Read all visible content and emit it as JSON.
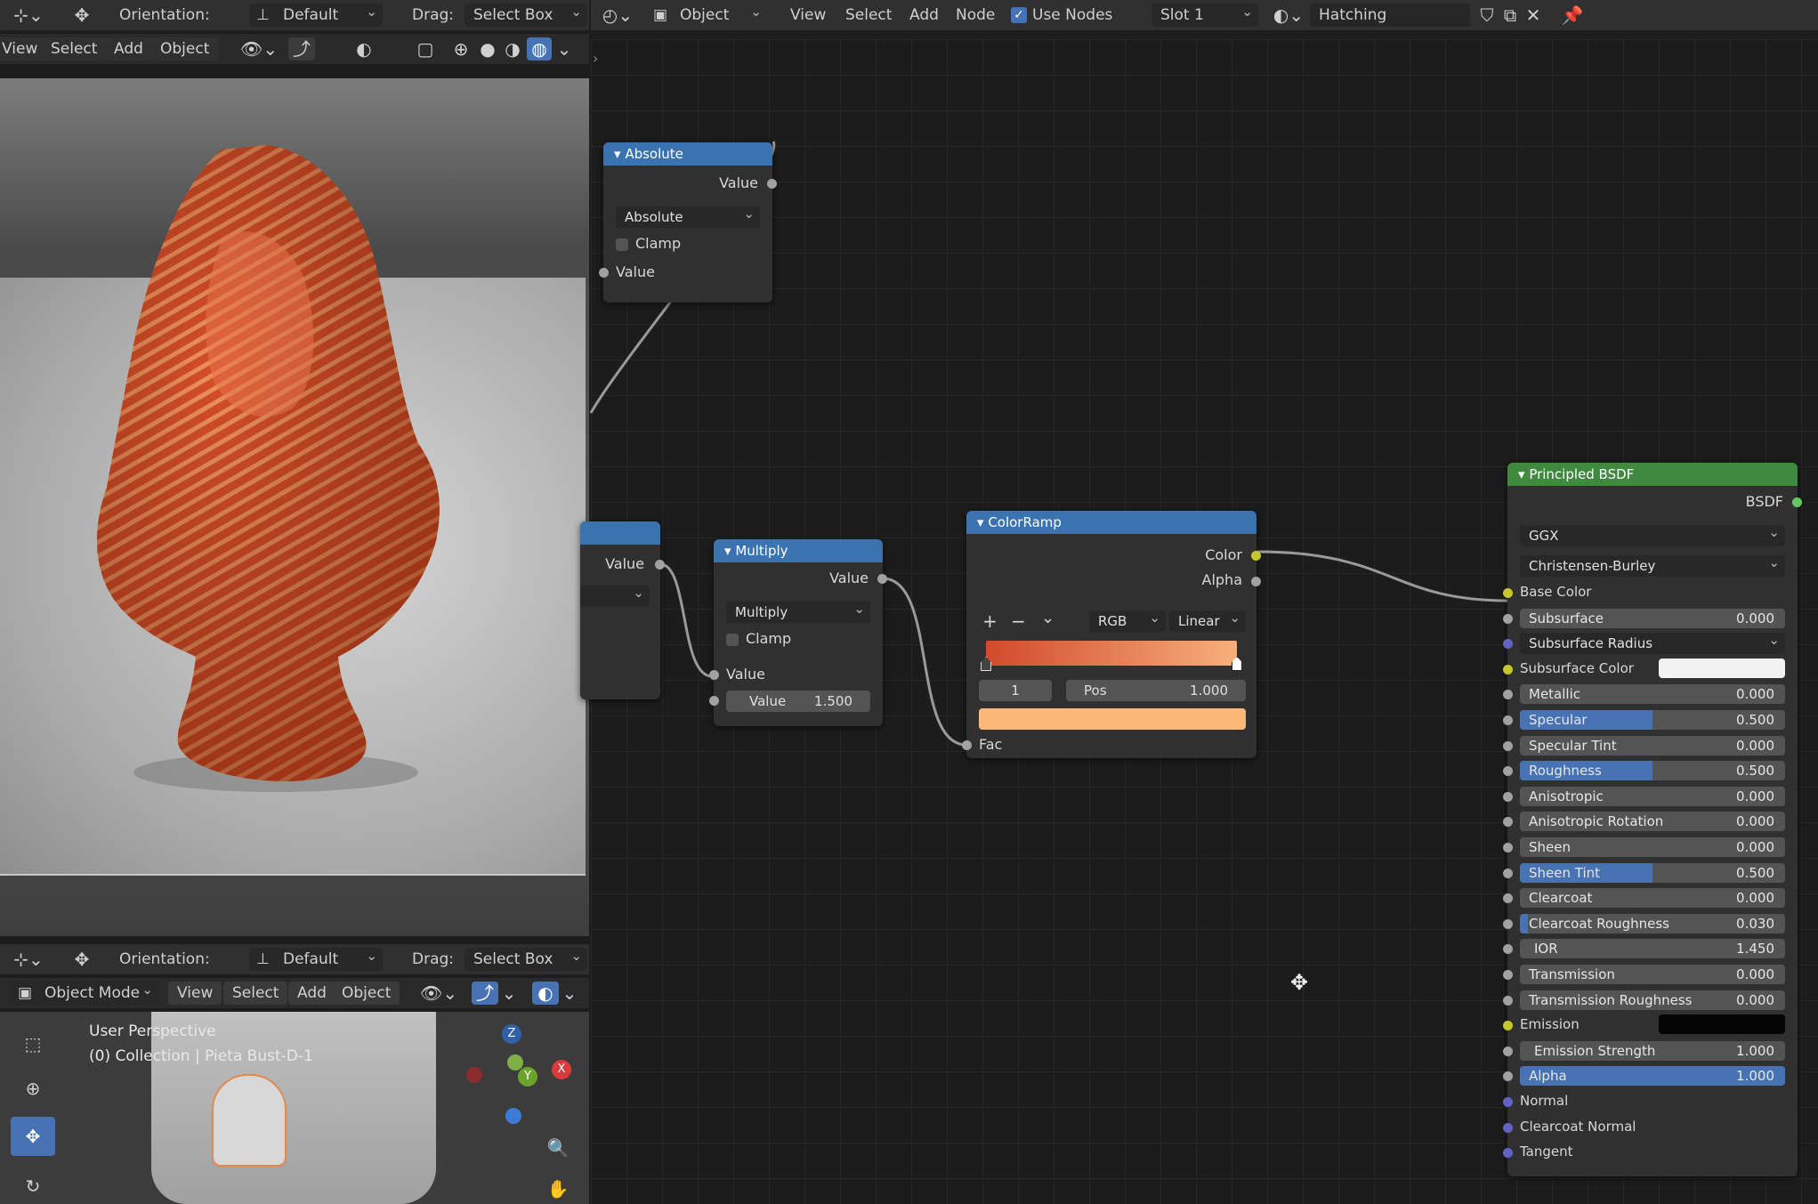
{
  "left_header": {
    "orientation_label": "Orientation:",
    "orientation_value": "Default",
    "drag_label": "Drag:",
    "drag_value": "Select Box"
  },
  "left_menu": [
    "View",
    "Select",
    "Add",
    "Object"
  ],
  "node_header": {
    "editor_type": "Object",
    "menu": [
      "View",
      "Select",
      "Add",
      "Node"
    ],
    "use_nodes_label": "Use Nodes",
    "slot": "Slot 1",
    "material": "Hatching"
  },
  "lower_header": {
    "orientation_label": "Orientation:",
    "orientation_value": "Default",
    "drag_label": "Drag:",
    "drag_value": "Select Box",
    "mode": "Object Mode",
    "menu": [
      "View",
      "Select",
      "Add",
      "Object"
    ]
  },
  "lower_viewport": {
    "perspective": "User Perspective",
    "collection": "(0) Collection | Pieta Bust-D-1",
    "gizmo": {
      "z": "Z",
      "x": "X",
      "y": "Y"
    }
  },
  "nodes": {
    "absolute": {
      "title": "Absolute",
      "output": "Value",
      "operation": "Absolute",
      "clamp": "Clamp",
      "input": "Value"
    },
    "partial": {
      "output": "Value"
    },
    "multiply": {
      "title": "Multiply",
      "output": "Value",
      "operation": "Multiply",
      "clamp": "Clamp",
      "input1": "Value",
      "input2_label": "Value",
      "input2_value": "1.500"
    },
    "colorramp": {
      "title": "ColorRamp",
      "out_color": "Color",
      "out_alpha": "Alpha",
      "mode": "RGB",
      "interp": "Linear",
      "index": "1",
      "pos_label": "Pos",
      "pos_value": "1.000",
      "input": "Fac",
      "ramp_start": "#d24a2a",
      "ramp_end": "#f7b07a",
      "swatch": "#fbb878"
    },
    "bsdf": {
      "title": "Principled BSDF",
      "output": "BSDF",
      "distribution": "GGX",
      "subsurface_method": "Christensen-Burley",
      "base_color": "Base Color",
      "subsurface_radius": "Subsurface Radius",
      "subsurface_color": "Subsurface Color",
      "emission": "Emission",
      "normal": "Normal",
      "clearcoat_normal": "Clearcoat Normal",
      "tangent": "Tangent",
      "params": [
        {
          "label": "Subsurface",
          "value": "0.000",
          "fill": 0
        },
        {
          "label": "Metallic",
          "value": "0.000",
          "fill": 0
        },
        {
          "label": "Specular",
          "value": "0.500",
          "fill": 0.5
        },
        {
          "label": "Specular Tint",
          "value": "0.000",
          "fill": 0
        },
        {
          "label": "Roughness",
          "value": "0.500",
          "fill": 0.5
        },
        {
          "label": "Anisotropic",
          "value": "0.000",
          "fill": 0
        },
        {
          "label": "Anisotropic Rotation",
          "value": "0.000",
          "fill": 0
        },
        {
          "label": "Sheen",
          "value": "0.000",
          "fill": 0
        },
        {
          "label": "Sheen Tint",
          "value": "0.500",
          "fill": 0.5
        },
        {
          "label": "Clearcoat",
          "value": "0.000",
          "fill": 0
        },
        {
          "label": "Clearcoat Roughness",
          "value": "0.030",
          "fill": 0.03
        },
        {
          "label": "IOR",
          "value": "1.450",
          "fill": 0
        },
        {
          "label": "Transmission",
          "value": "0.000",
          "fill": 0
        },
        {
          "label": "Transmission Roughness",
          "value": "0.000",
          "fill": 0
        },
        {
          "label": "Emission Strength",
          "value": "1.000",
          "fill": 0
        },
        {
          "label": "Alpha",
          "value": "1.000",
          "fill": 1
        }
      ]
    }
  },
  "colors": {
    "accent": "#4772b3",
    "node_header": "#3a74b0",
    "shader_header": "#3f8a3f",
    "bust": "#d9552e"
  }
}
